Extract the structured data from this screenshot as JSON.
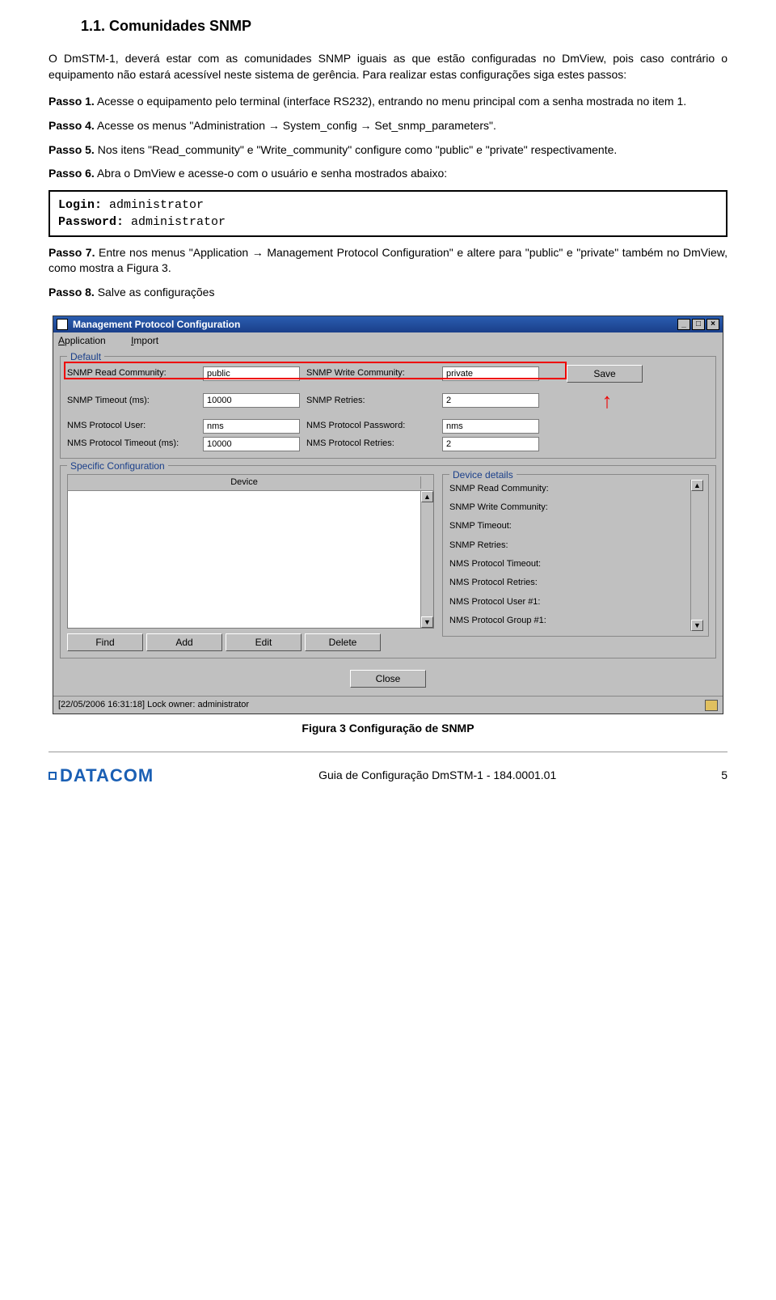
{
  "section_title": "1.1. Comunidades SNMP",
  "intro": "O DmSTM-1, deverá estar com as comunidades SNMP iguais as que estão configuradas no DmView, pois caso contrário o equipamento não estará acessível neste sistema de gerência. Para realizar estas configurações siga estes passos:",
  "steps": {
    "p1_label": "Passo 1.",
    "p1_text": " Acesse o equipamento pelo terminal (interface RS232), entrando no menu principal com a senha mostrada no item 1.",
    "p4_label": "Passo 4.",
    "p4_text": " Acesse os menus \"Administration → System_config → Set_snmp_parameters\".",
    "p5_label": "Passo 5.",
    "p5_text": " Nos itens \"Read_community\" e \"Write_community\" configure como \"public\" e \"private\" respectivamente.",
    "p6_label": "Passo 6.",
    "p6_text": " Abra o DmView e acesse-o com o usuário e senha mostrados abaixo:",
    "p7_label": "Passo 7.",
    "p7_text": " Entre nos menus \"Application → Management Protocol Configuration\" e altere para \"public\" e \"private\" também no DmView, como mostra a Figura 3.",
    "p8_label": "Passo 8.",
    "p8_text": " Salve as configurações"
  },
  "login": {
    "login_label": "Login:",
    "login_value": " administrator",
    "pass_label": "Password:",
    "pass_value": " administrator"
  },
  "caption": "Figura 3 Configuração de SNMP",
  "win": {
    "title": "Management Protocol Configuration",
    "menu1": "Application",
    "menu2": "Import",
    "default_legend": "Default",
    "labels": {
      "read": "SNMP Read Community:",
      "write": "SNMP Write Community:",
      "timeout": "SNMP Timeout (ms):",
      "retries": "SNMP Retries:",
      "nmsuser": "NMS Protocol User:",
      "nmspass": "NMS Protocol Password:",
      "nmstimeout": "NMS Protocol Timeout (ms):",
      "nmsretries": "NMS Protocol Retries:"
    },
    "values": {
      "read": "public",
      "write": "private",
      "timeout": "10000",
      "retries": "2",
      "nmsuser": "nms",
      "nmspass": "nms",
      "nmstimeout": "10000",
      "nmsretries": "2"
    },
    "save_btn": "Save",
    "spec_legend": "Specific Configuration",
    "device_header": "Device",
    "details_legend": "Device details",
    "detrows": {
      "r1": "SNMP Read Community:",
      "r2": "SNMP Write Community:",
      "r3": "SNMP Timeout:",
      "r4": "SNMP Retries:",
      "r5": "NMS Protocol Timeout:",
      "r6": "NMS Protocol Retries:",
      "r7": "NMS Protocol User #1:",
      "r8": "NMS Protocol Group #1:"
    },
    "btns": {
      "find": "Find",
      "add": "Add",
      "edit": "Edit",
      "del": "Delete",
      "close": "Close"
    },
    "status": "[22/05/2006 16:31:18] Lock owner: administrator"
  },
  "footer": {
    "logo": "DATACOM",
    "center": "Guia de Configuração DmSTM-1 - 184.0001.01",
    "page": "5"
  }
}
